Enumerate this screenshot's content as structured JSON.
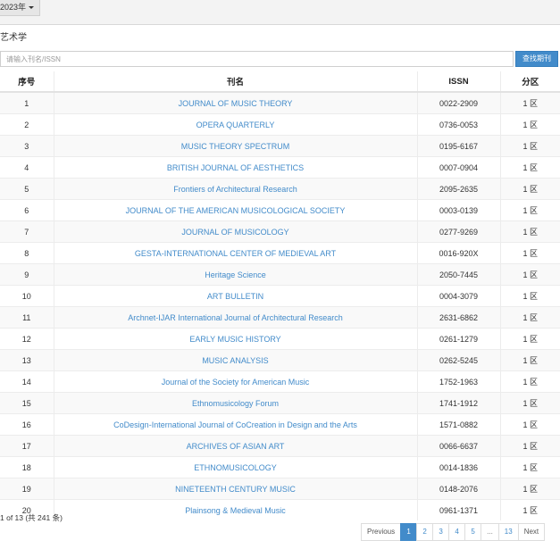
{
  "header": {
    "year_label": "2023年"
  },
  "subject": {
    "label": "艺术学"
  },
  "search": {
    "placeholder": "请输入刊名/ISSN",
    "value": "",
    "button_label": "查找期刊"
  },
  "table": {
    "columns": [
      "序号",
      "刊名",
      "ISSN",
      "分区"
    ],
    "rows": [
      {
        "index": "1",
        "name": "JOURNAL OF MUSIC THEORY",
        "issn": "0022-2909",
        "zone": "1 区"
      },
      {
        "index": "2",
        "name": "OPERA QUARTERLY",
        "issn": "0736-0053",
        "zone": "1 区"
      },
      {
        "index": "3",
        "name": "MUSIC THEORY SPECTRUM",
        "issn": "0195-6167",
        "zone": "1 区"
      },
      {
        "index": "4",
        "name": "BRITISH JOURNAL OF AESTHETICS",
        "issn": "0007-0904",
        "zone": "1 区"
      },
      {
        "index": "5",
        "name": "Frontiers of Architectural Research",
        "issn": "2095-2635",
        "zone": "1 区"
      },
      {
        "index": "6",
        "name": "JOURNAL OF THE AMERICAN MUSICOLOGICAL SOCIETY",
        "issn": "0003-0139",
        "zone": "1 区"
      },
      {
        "index": "7",
        "name": "JOURNAL OF MUSICOLOGY",
        "issn": "0277-9269",
        "zone": "1 区"
      },
      {
        "index": "8",
        "name": "GESTA-INTERNATIONAL CENTER OF MEDIEVAL ART",
        "issn": "0016-920X",
        "zone": "1 区"
      },
      {
        "index": "9",
        "name": "Heritage Science",
        "issn": "2050-7445",
        "zone": "1 区"
      },
      {
        "index": "10",
        "name": "ART BULLETIN",
        "issn": "0004-3079",
        "zone": "1 区"
      },
      {
        "index": "11",
        "name": "Archnet-IJAR International Journal of Architectural Research",
        "issn": "2631-6862",
        "zone": "1 区"
      },
      {
        "index": "12",
        "name": "EARLY MUSIC HISTORY",
        "issn": "0261-1279",
        "zone": "1 区"
      },
      {
        "index": "13",
        "name": "MUSIC ANALYSIS",
        "issn": "0262-5245",
        "zone": "1 区"
      },
      {
        "index": "14",
        "name": "Journal of the Society for American Music",
        "issn": "1752-1963",
        "zone": "1 区"
      },
      {
        "index": "15",
        "name": "Ethnomusicology Forum",
        "issn": "1741-1912",
        "zone": "1 区"
      },
      {
        "index": "16",
        "name": "CoDesign-International Journal of CoCreation in Design and the Arts",
        "issn": "1571-0882",
        "zone": "1 区"
      },
      {
        "index": "17",
        "name": "ARCHIVES OF ASIAN ART",
        "issn": "0066-6637",
        "zone": "1 区"
      },
      {
        "index": "18",
        "name": "ETHNOMUSICOLOGY",
        "issn": "0014-1836",
        "zone": "1 区"
      },
      {
        "index": "19",
        "name": "NINETEENTH CENTURY MUSIC",
        "issn": "0148-2076",
        "zone": "1 区"
      },
      {
        "index": "20",
        "name": "Plainsong & Medieval Music",
        "issn": "0961-1371",
        "zone": "1 区"
      }
    ]
  },
  "summary": "1 of 13 (共 241 条)",
  "pagination": {
    "prev_label": "Previous",
    "pages": [
      "1",
      "2",
      "3",
      "4",
      "5",
      "...",
      "13"
    ],
    "active_page": "1",
    "next_label": "Next"
  }
}
